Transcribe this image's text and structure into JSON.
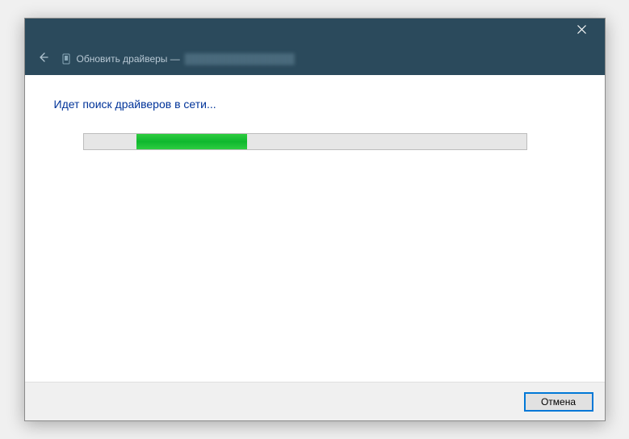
{
  "header": {
    "title_prefix": "Обновить драйверы —",
    "device_name": "████████████████"
  },
  "content": {
    "status_text": "Идет поиск драйверов в сети...",
    "progress": {
      "indeterminate": true,
      "segment_start_pct": 12,
      "segment_width_pct": 25
    }
  },
  "footer": {
    "cancel_label": "Отмена"
  },
  "colors": {
    "header_bg": "#2b4a5c",
    "status_text": "#003399",
    "progress_fill": "#0fb82e",
    "button_focus": "#0078d7"
  }
}
